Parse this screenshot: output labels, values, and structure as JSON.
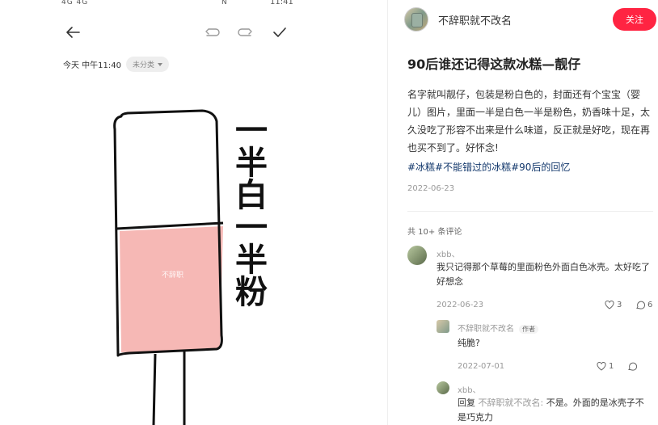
{
  "left": {
    "status_left": "4G 4G",
    "status_right": "N",
    "status_time": "11:41",
    "meta": {
      "date": "今天 中午11:40",
      "category": "未分类"
    },
    "handwriting": "一半白一半粉",
    "watermark": "不辞职"
  },
  "right": {
    "author": {
      "name": "不辞职就不改名"
    },
    "follow_label": "关注",
    "title": "90后谁还记得这款冰糕—靓仔",
    "body": "名字就叫靓仔，包装是粉白色的，封面还有个宝宝（婴儿）图片，里面一半是白色一半是粉色，奶香味十足，太久没吃了形容不出来是什么味道，反正就是好吃，现在再也买不到了。好怀念!",
    "tags": "#冰糕#不能错过的冰糕#90后的回忆",
    "date": "2022-06-23",
    "comments_count": "共 10+ 条评论",
    "comments": [
      {
        "name": "xbb、",
        "text": "我只记得那个草莓的里面粉色外面白色冰壳。太好吃了好想念",
        "date": "2022-06-23",
        "likes": "3",
        "replies": "6"
      },
      {
        "name": "不辞职就不改名",
        "badge": "作者",
        "text": "纯脆?",
        "date": "2022-07-01",
        "likes": "1",
        "replies": ""
      },
      {
        "name": "xbb、",
        "reply_prefix": "回复",
        "reply_to": "不辞职就不改名:",
        "text": "不是。外面的是冰壳子不是巧克力"
      }
    ]
  }
}
